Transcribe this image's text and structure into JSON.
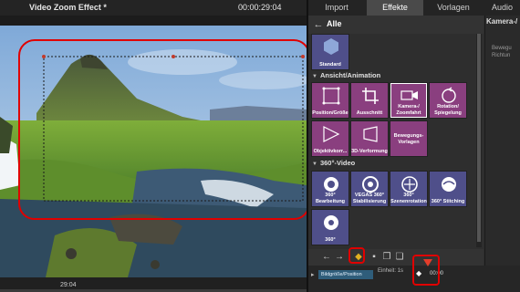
{
  "preview": {
    "title": "Video Zoom Effect *",
    "timecode": "00:00:29:04",
    "timeline_tick": "29:04"
  },
  "tabs": [
    {
      "label": "Import",
      "active": false
    },
    {
      "label": "Effekte",
      "active": true
    },
    {
      "label": "Vorlagen",
      "active": false
    },
    {
      "label": "Audio",
      "active": false
    }
  ],
  "nav": {
    "label": "Alle"
  },
  "side_panel": {
    "header": "Kamera-/",
    "sub1": "Bewegu",
    "sub2": "Richtun"
  },
  "grid": {
    "standard": "Standard",
    "section1": "Ansicht/Animation",
    "section2": "360°-Video",
    "tiles1": [
      {
        "label": "Position/Größe",
        "icon": "position-icon"
      },
      {
        "label": "Ausschnitt",
        "icon": "crop-icon"
      },
      {
        "label": "Kamera-/ Zoomfahrt",
        "icon": "camera-zoom-icon"
      },
      {
        "label": "Rotation/ Spiegelung",
        "icon": "rotation-icon"
      },
      {
        "label": "Objektivkorr...",
        "icon": "lens-icon"
      },
      {
        "label": "3D-Verformung",
        "icon": "3d-warp-icon"
      },
      {
        "label": "Bewegungs- Vorlagen",
        "icon": ""
      }
    ],
    "tiles2": [
      {
        "label": "360° Bearbeitung",
        "icon": "360-edit-icon"
      },
      {
        "label": "VEGAS 360° Stabilisierung",
        "icon": "360-stabilize-icon"
      },
      {
        "label": "360° Szenenrotation",
        "icon": "360-rotation-icon"
      },
      {
        "label": "360° Stitching",
        "icon": "360-stitching-icon"
      },
      {
        "label": "360°",
        "icon": "360-icon"
      }
    ]
  },
  "controls": {
    "einheit": "Einheit: 1s",
    "keyframe_label": "Bildgröße/Position",
    "keyframe_time": "00:00"
  },
  "colors": {
    "highlight": "#e00000",
    "tile_purple": "#8a3f7f",
    "tile_blue": "#4f4f8a"
  }
}
